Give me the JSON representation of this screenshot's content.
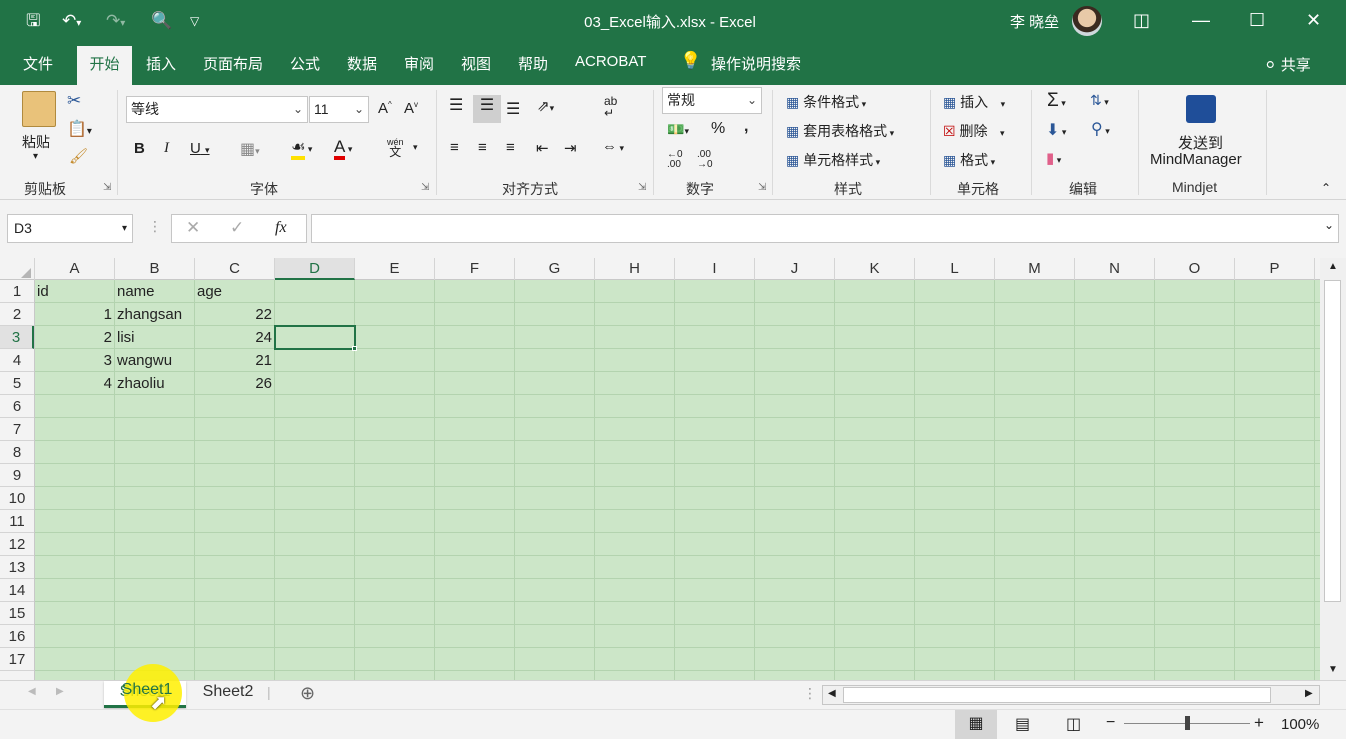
{
  "window": {
    "title": "03_Excel输入.xlsx  -  Excel",
    "user": "李 晓垒",
    "quick_access": {
      "save_icon": "save-icon",
      "undo_icon": "undo-icon",
      "redo_icon": "redo-icon",
      "print_preview_icon": "print-preview-icon",
      "customize_icon": "customize-icon"
    },
    "controls": {
      "ribbon_display": "ribbon-display-icon",
      "minimize": "minimize-icon",
      "maximize": "maximize-icon",
      "close": "close-icon"
    }
  },
  "tabs": [
    "文件",
    "开始",
    "插入",
    "页面布局",
    "公式",
    "数据",
    "审阅",
    "视图",
    "帮助",
    "ACROBAT"
  ],
  "active_tab": "开始",
  "tell_me": "操作说明搜索",
  "share": "共享",
  "ribbon": {
    "clipboard": {
      "label": "剪贴板",
      "paste": "粘贴"
    },
    "font": {
      "label": "字体",
      "font_name": "等线",
      "font_size": "11",
      "bold": "B",
      "italic": "I",
      "underline": "U",
      "grow": "A",
      "shrink": "A",
      "wen": "wén",
      "wen_char": "文"
    },
    "alignment": {
      "label": "对齐方式"
    },
    "number": {
      "label": "数字",
      "format": "常规",
      "percent": "%",
      "comma": ","
    },
    "styles": {
      "label": "样式",
      "conditional": "条件格式",
      "table": "套用表格格式",
      "cell": "单元格样式"
    },
    "cells": {
      "label": "单元格",
      "insert": "插入",
      "delete": "删除",
      "format": "格式"
    },
    "editing": {
      "label": "编辑",
      "sigma": "Σ"
    },
    "mindjet": {
      "label": "Mindjet",
      "send_line1": "发送到",
      "send_line2": "MindManager"
    }
  },
  "formula_bar": {
    "name_box": "D3",
    "fx": "fx",
    "formula": ""
  },
  "columns": [
    "A",
    "B",
    "C",
    "D",
    "E",
    "F",
    "G",
    "H",
    "I",
    "J",
    "K",
    "L",
    "M",
    "N",
    "O",
    "P"
  ],
  "active_column": "D",
  "rows": [
    "1",
    "2",
    "3",
    "4",
    "5",
    "6",
    "7",
    "8",
    "9",
    "10",
    "11",
    "12",
    "13",
    "14",
    "15",
    "16",
    "17"
  ],
  "active_row": "3",
  "cells": {
    "A1": "id",
    "B1": "name",
    "C1": "age",
    "A2": "1",
    "B2": "zhangsan",
    "C2": "22",
    "A3": "2",
    "B3": "lisi",
    "C3": "24",
    "A4": "3",
    "B4": "wangwu",
    "C4": "21",
    "A5": "4",
    "B5": "zhaoliu",
    "C5": "26"
  },
  "selected_cell": "D3",
  "sheet_tabs": [
    "Sheet1",
    "Sheet2"
  ],
  "active_sheet": "Sheet1",
  "status": {
    "zoom": "100%",
    "zoom_level_fraction": 0.5,
    "zoom_minus": "−",
    "zoom_plus": "+"
  },
  "colors": {
    "excel_green": "#217346",
    "cell_bg": "#cce6c8",
    "highlight": "#fff000"
  }
}
